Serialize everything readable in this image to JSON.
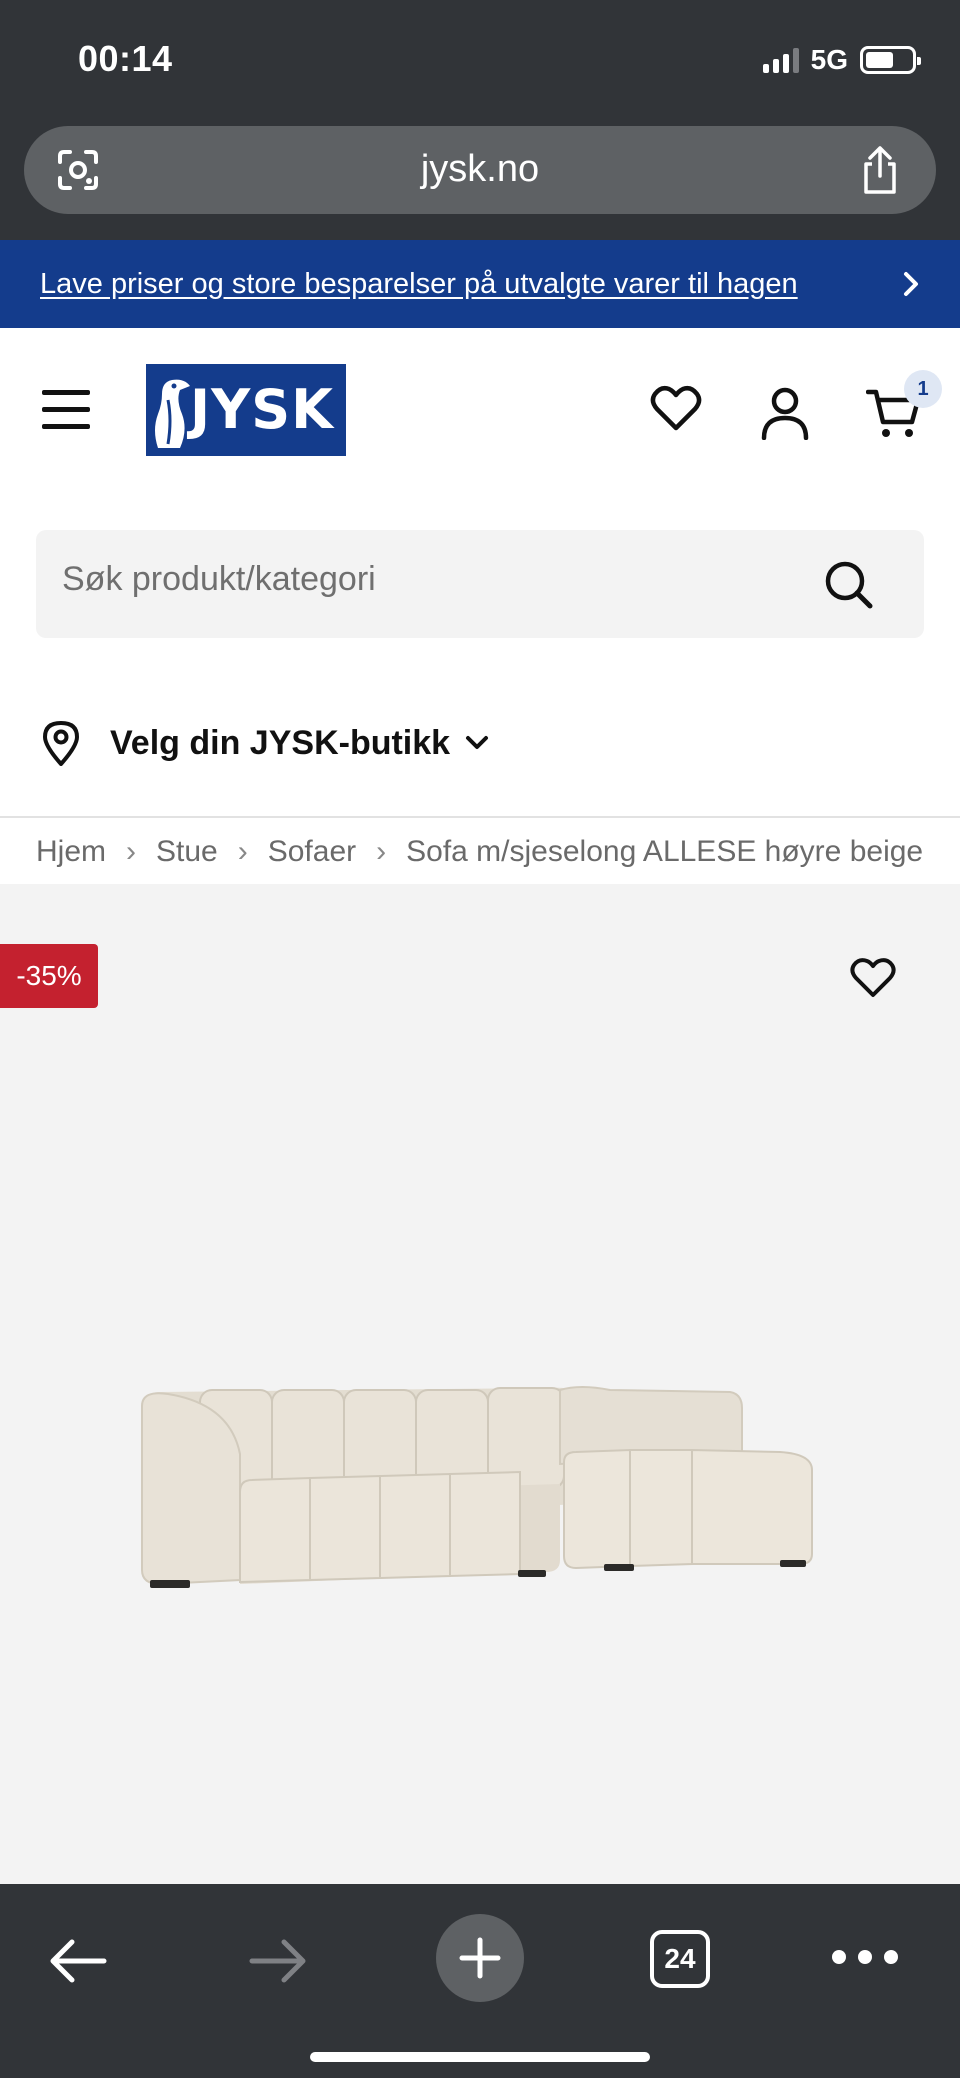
{
  "status_bar": {
    "time": "00:14",
    "network": "5G"
  },
  "browser": {
    "url": "jysk.no",
    "tab_count": "24"
  },
  "promo": {
    "text": "Lave priser og store besparelser på utvalgte varer til hagen"
  },
  "header": {
    "logo_text": "JYSK",
    "cart_count": "1",
    "search_placeholder": "Søk produkt/kategori",
    "store_label": "Velg din JYSK-butikk"
  },
  "breadcrumb": {
    "items": [
      "Hjem",
      "Stue",
      "Sofaer",
      "Sofa m/sjeselong ALLESE høyre beige"
    ]
  },
  "product": {
    "discount_badge": "-35%",
    "name": "Sofa m/sjeselong ALLESE høyre beige"
  },
  "colors": {
    "brand_blue": "#143c8c",
    "discount_red": "#c4212f",
    "chrome_dark": "#313438"
  },
  "icons": {
    "lens": "google-lens-icon",
    "share": "share-icon",
    "promo_chevron": "chevron-right-icon",
    "menu": "hamburger-menu-icon",
    "wishlist": "heart-icon",
    "account": "user-icon",
    "cart": "cart-icon",
    "search": "search-icon",
    "store": "location-pin-icon",
    "store_chevron": "chevron-down-icon",
    "back": "arrow-left-icon",
    "forward": "arrow-right-icon",
    "new_tab": "plus-icon",
    "more": "more-icon"
  }
}
